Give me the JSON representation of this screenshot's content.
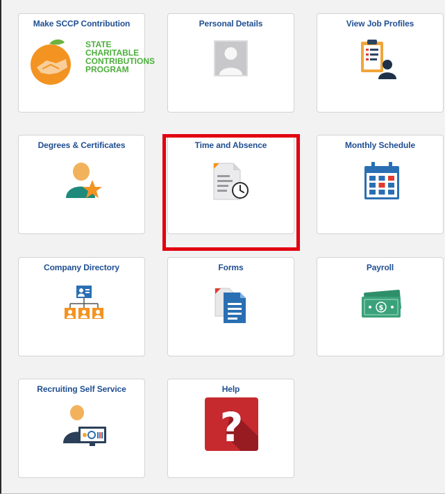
{
  "tiles": [
    {
      "id": "sccp",
      "title": "Make SCCP Contribution",
      "icon": "sccp-logo-icon",
      "logo_lines": [
        "STATE",
        "CHARITABLE",
        "CONTRIBUTIONS",
        "PROGRAM"
      ]
    },
    {
      "id": "personal",
      "title": "Personal Details",
      "icon": "person-placeholder-icon"
    },
    {
      "id": "jobprofiles",
      "title": "View Job Profiles",
      "icon": "clipboard-person-icon"
    },
    {
      "id": "degrees",
      "title": "Degrees & Certificates",
      "icon": "person-star-icon"
    },
    {
      "id": "timeabsence",
      "title": "Time and Absence",
      "icon": "document-clock-icon"
    },
    {
      "id": "monthly",
      "title": "Monthly Schedule",
      "icon": "calendar-icon"
    },
    {
      "id": "directory",
      "title": "Company Directory",
      "icon": "org-chart-icon"
    },
    {
      "id": "forms",
      "title": "Forms",
      "icon": "forms-document-icon"
    },
    {
      "id": "payroll",
      "title": "Payroll",
      "icon": "money-bill-icon"
    },
    {
      "id": "recruiting",
      "title": "Recruiting Self Service",
      "icon": "recruiting-icon"
    },
    {
      "id": "help",
      "title": "Help",
      "icon": "help-question-icon"
    }
  ],
  "highlighted_tile": "Time and Absence",
  "colors": {
    "title_blue": "#1f4e91",
    "highlight_red": "#e1000f",
    "help_red": "#c62a2f",
    "sccp_green": "#4caf3b",
    "sccp_orange": "#f39322"
  }
}
